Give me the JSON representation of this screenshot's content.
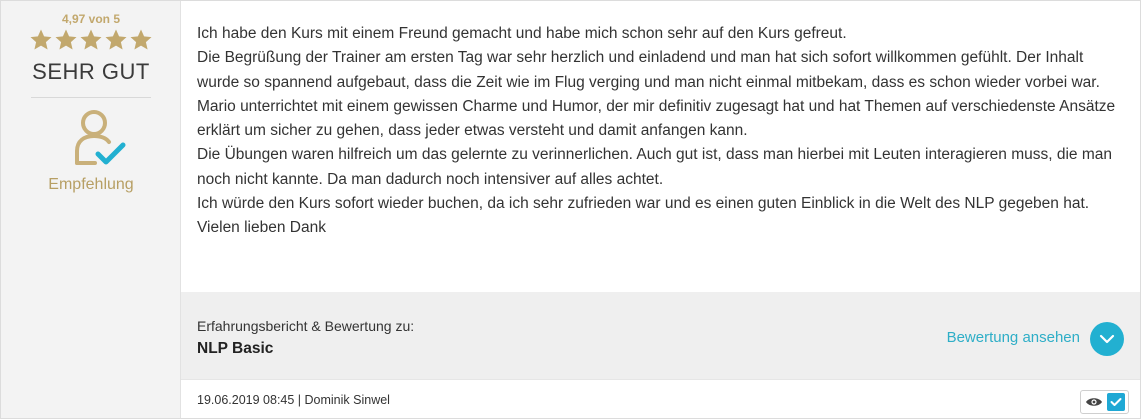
{
  "rating": {
    "score_text": "4,97 von 5",
    "stars": 5,
    "grade": "SEHR GUT",
    "recommendation_label": "Empfehlung",
    "star_color": "#c2a86d"
  },
  "review": {
    "paragraphs": [
      "Ich habe den Kurs mit einem Freund gemacht und habe mich schon sehr auf den Kurs gefreut.",
      "Die Begrüßung der Trainer am ersten Tag war sehr herzlich und einladend und man hat sich sofort willkommen gefühlt. Der Inhalt wurde so spannend aufgebaut, dass die Zeit wie im Flug verging und man nicht einmal mitbekam, dass es schon wieder vorbei war.",
      "Mario unterrichtet mit einem gewissen Charme und Humor, der mir definitiv zugesagt hat und hat Themen auf verschiedenste Ansätze erklärt um sicher zu gehen, dass jeder etwas versteht und damit anfangen kann.",
      "Die Übungen waren hilfreich um das gelernte zu verinnerlichen. Auch gut ist, dass man hierbei mit Leuten interagieren muss, die man noch nicht kannte. Da man dadurch noch intensiver auf alles achtet.",
      "Ich würde den Kurs sofort wieder buchen, da ich sehr zufrieden war und es einen guten Einblick in die Welt des NLP gegeben hat. Vielen lieben Dank"
    ]
  },
  "course": {
    "label": "Erfahrungsbericht & Bewertung zu:",
    "name": "NLP Basic",
    "view_link": "Bewertung ansehen",
    "accent_color": "#22b0d1"
  },
  "footer": {
    "meta": "19.06.2019 08:45 | Dominik Sinwel"
  },
  "icons": {
    "star": "star-icon",
    "recommendation": "user-check-icon",
    "chevron": "chevron-down-icon",
    "eye": "eye-icon",
    "verified": "checkmark-icon"
  }
}
